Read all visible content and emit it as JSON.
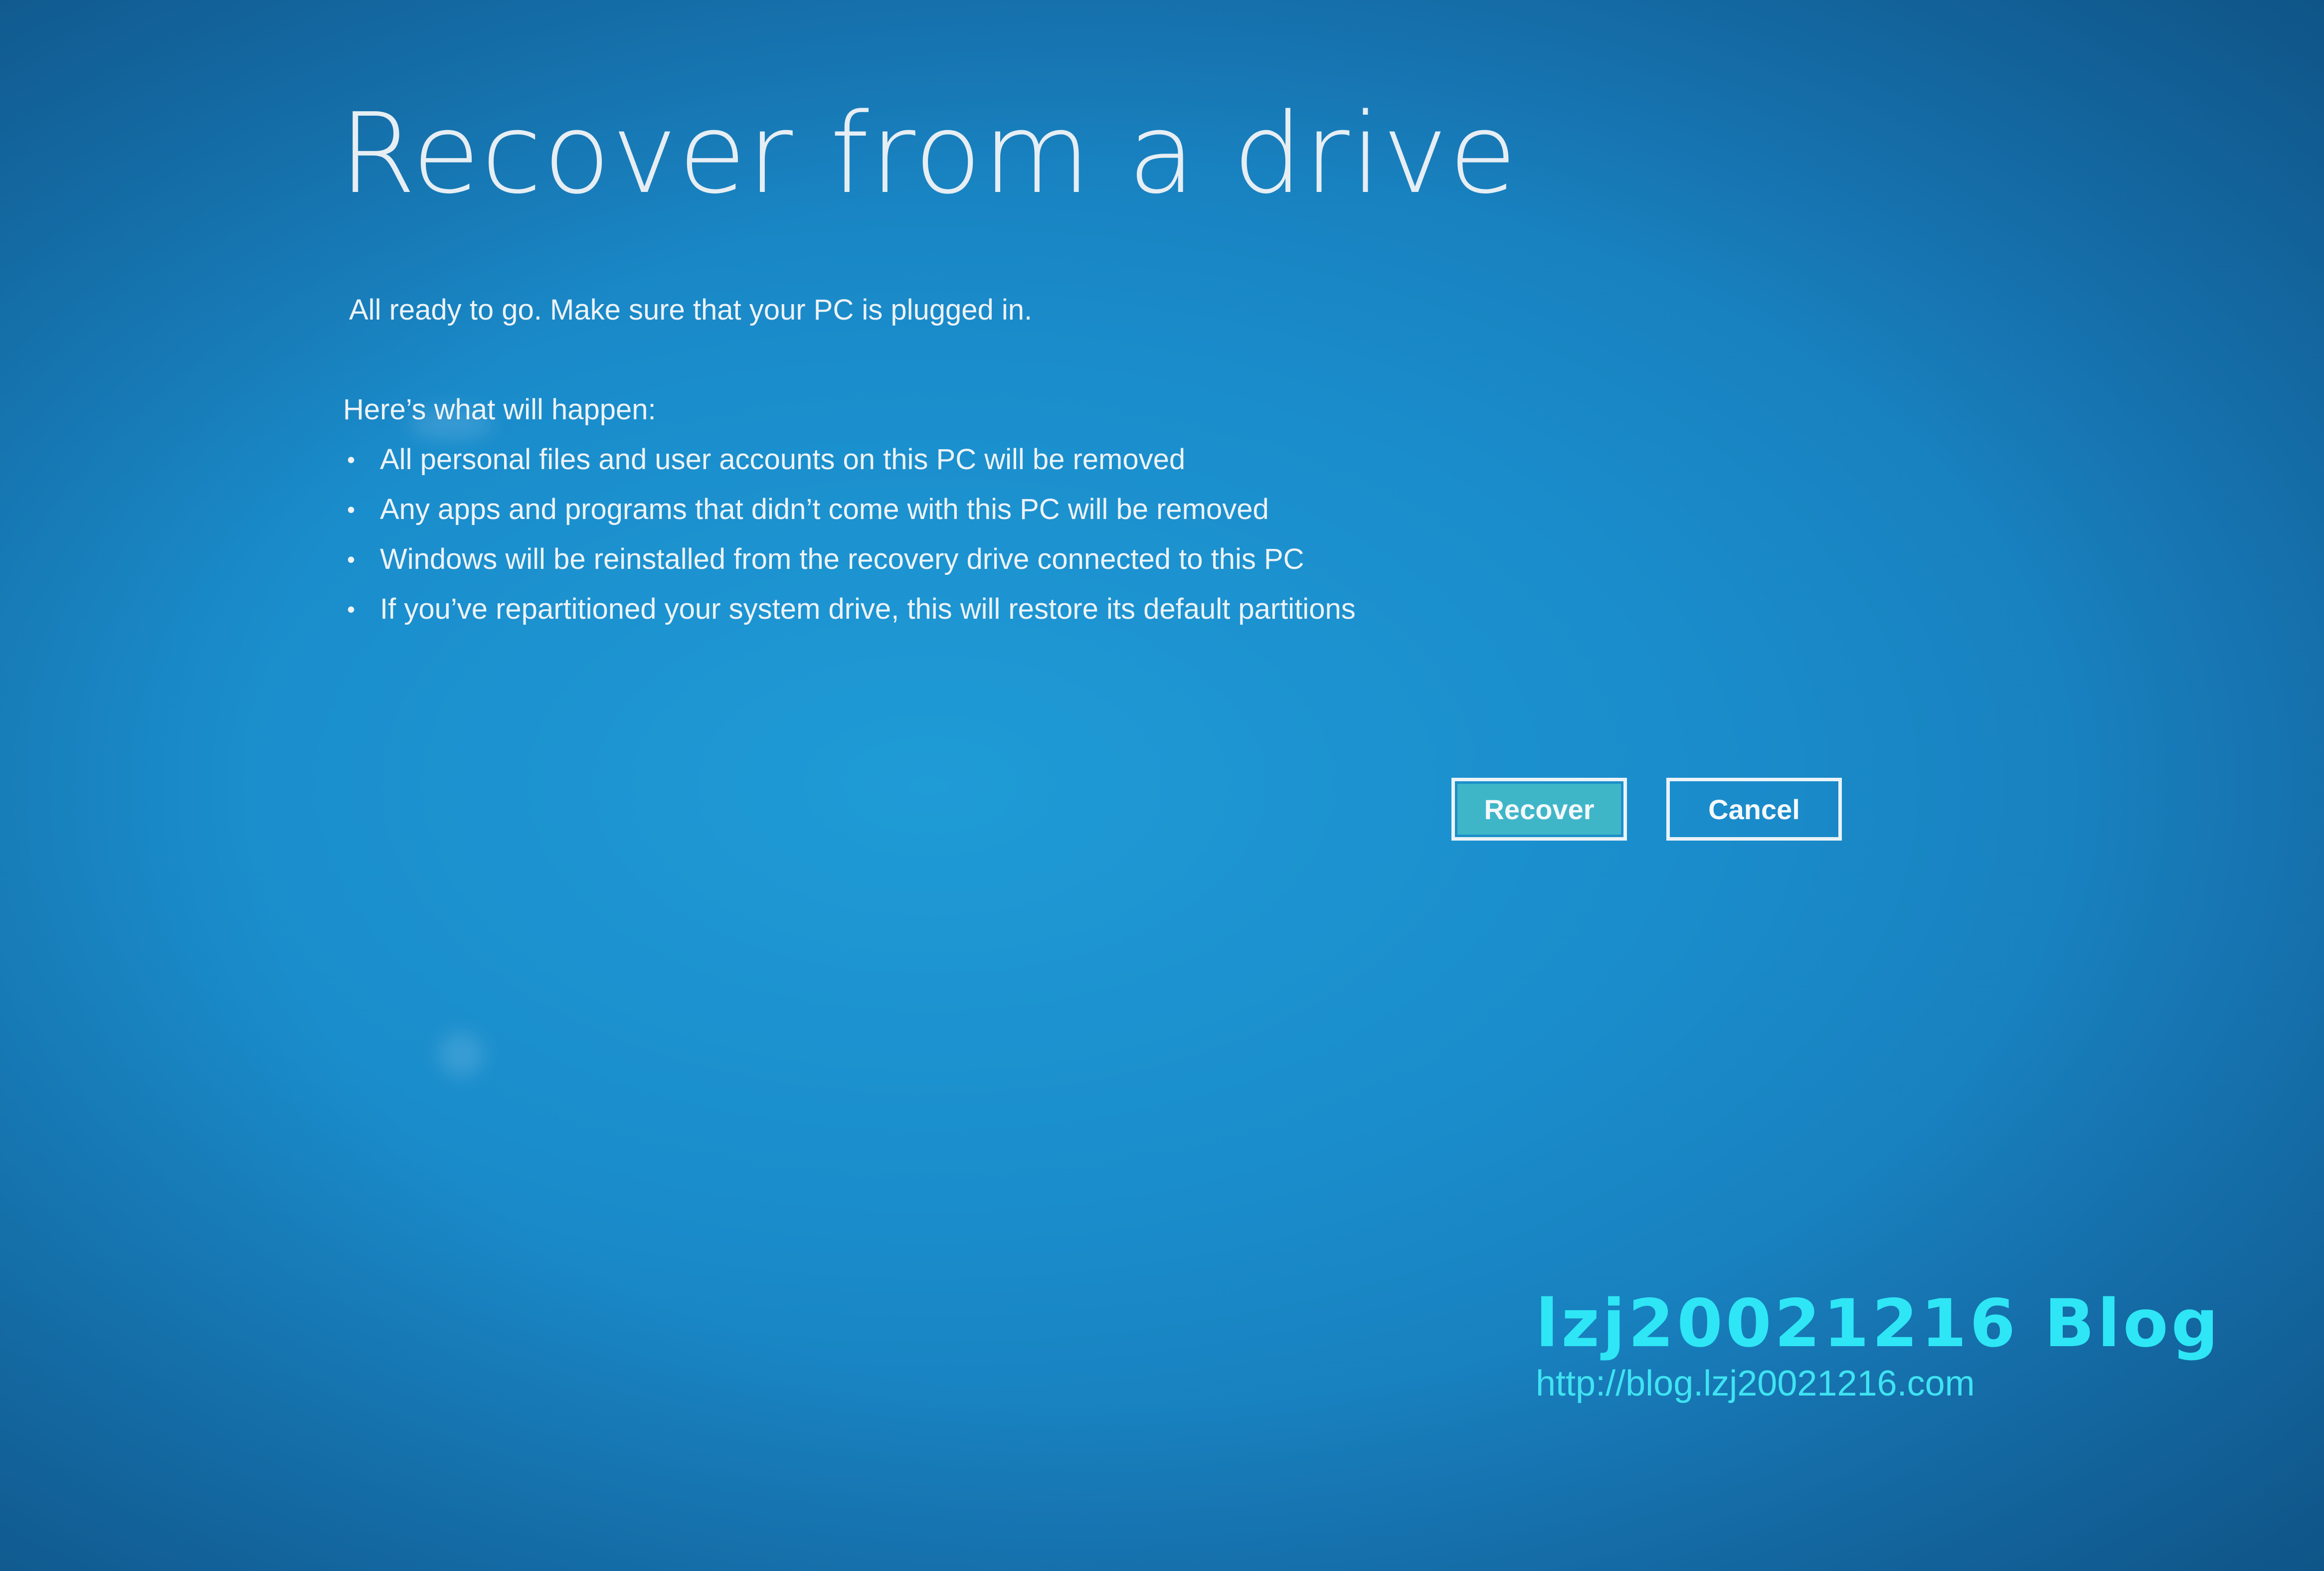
{
  "screen": {
    "title": "Recover from a drive",
    "subtitle": "All ready to go. Make sure that your PC is plugged in.",
    "happen_heading": "Here’s what will happen:",
    "bullets": [
      "All personal files and user accounts on this PC will be removed",
      "Any apps and programs that didn’t come with this PC will be removed",
      "Windows will be reinstalled from the recovery drive connected to this PC",
      "If you’ve repartitioned your system drive, this will restore its default partitions"
    ],
    "bullet_glyph": "•"
  },
  "buttons": {
    "recover_label": "Recover",
    "cancel_label": "Cancel"
  },
  "watermark": {
    "title": "lzj20021216 Blog",
    "url": "http://blog.lzj20021216.com"
  },
  "colors": {
    "background": "#1a8ccb",
    "accent_button": "#3fb6c8",
    "watermark": "#2ee6f5"
  }
}
